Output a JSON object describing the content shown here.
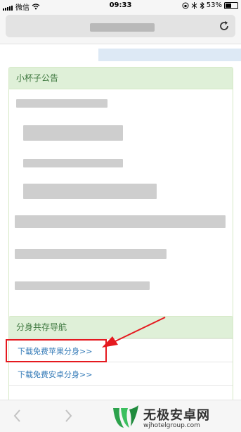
{
  "status_bar": {
    "carrier": "微信",
    "time": "09:33",
    "battery_text": "53%",
    "battery_level": 0.53
  },
  "icons": {
    "reload": "reload-icon",
    "back": "chevron-left-icon",
    "forward": "chevron-right-icon",
    "warning": "arrow-pointer"
  },
  "notice_panel": {
    "title": "小杯子公告"
  },
  "nav_panel": {
    "title": "分身共存导航",
    "items": [
      {
        "label": "下载免费苹果分身>>"
      },
      {
        "label": "下载免费安卓分身>>"
      }
    ]
  },
  "watermark": {
    "title": "无极安卓网",
    "subtitle": "wjhotelgroup.com"
  },
  "colors": {
    "panel_heading_bg": "#dff0d8",
    "panel_heading_text": "#3c763d",
    "link": "#337ab7",
    "highlight": "#e5191f"
  }
}
